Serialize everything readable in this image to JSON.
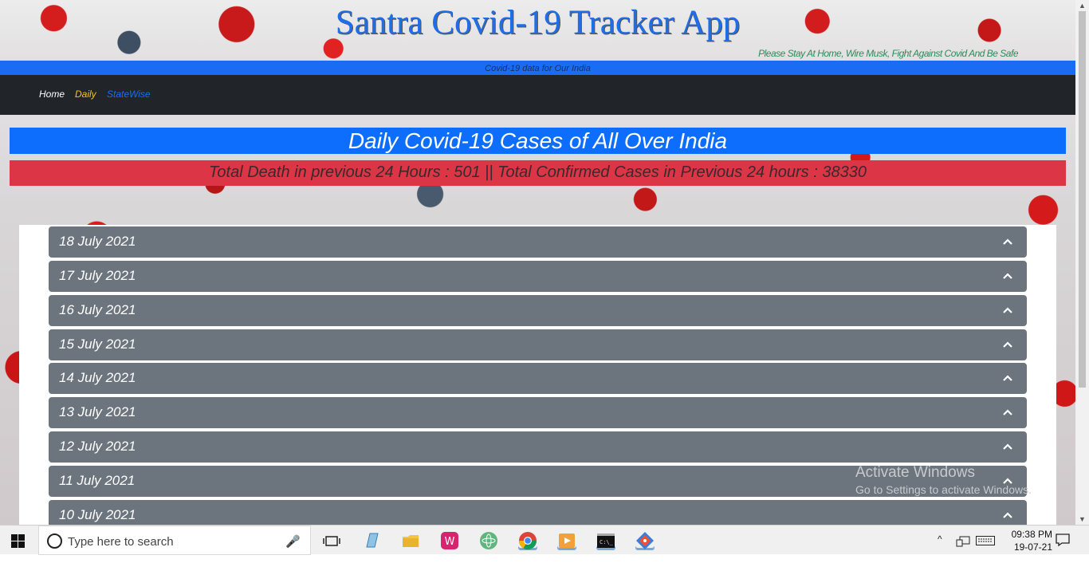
{
  "header": {
    "title": "Santra Covid-19 Tracker App",
    "tagline": "Please Stay At Home, Wire Musk, Fight Against Covid And Be Safe",
    "subtitle": "Covid-19 data for Our India"
  },
  "nav": {
    "items": [
      {
        "label": "Home",
        "color": "#ffffff"
      },
      {
        "label": "Daily",
        "color": "#f5c518"
      },
      {
        "label": "StateWise",
        "color": "#1a6df2"
      }
    ]
  },
  "hero": {
    "heading": "Daily Covid-19 Cases of All Over India",
    "summary": "Total Death in previous 24 Hours : 501 || Total Confirmed Cases in Previous 24 hours : 38330"
  },
  "accordion": {
    "items": [
      {
        "date": "18 July 2021"
      },
      {
        "date": "17 July 2021"
      },
      {
        "date": "16 July 2021"
      },
      {
        "date": "15 July 2021"
      },
      {
        "date": "14 July 2021"
      },
      {
        "date": "13 July 2021"
      },
      {
        "date": "12 July 2021"
      },
      {
        "date": "11 July 2021"
      },
      {
        "date": "10 July 2021"
      }
    ]
  },
  "watermark": {
    "line1": "Activate Windows",
    "line2": "Go to Settings to activate Windows."
  },
  "taskbar": {
    "search_placeholder": "Type here to search",
    "time": "09:38 PM",
    "date": "19-07-21",
    "apps": [
      {
        "name": "task-view-icon"
      },
      {
        "name": "notepad-icon"
      },
      {
        "name": "file-explorer-icon"
      },
      {
        "name": "wamp-icon"
      },
      {
        "name": "atom-icon"
      },
      {
        "name": "chrome-icon"
      },
      {
        "name": "media-player-icon"
      },
      {
        "name": "terminal-icon"
      },
      {
        "name": "git-icon"
      }
    ]
  },
  "colors": {
    "primary": "#0d6efd",
    "danger": "#dc3545",
    "secondary": "#6c757d",
    "dark": "#212529"
  }
}
